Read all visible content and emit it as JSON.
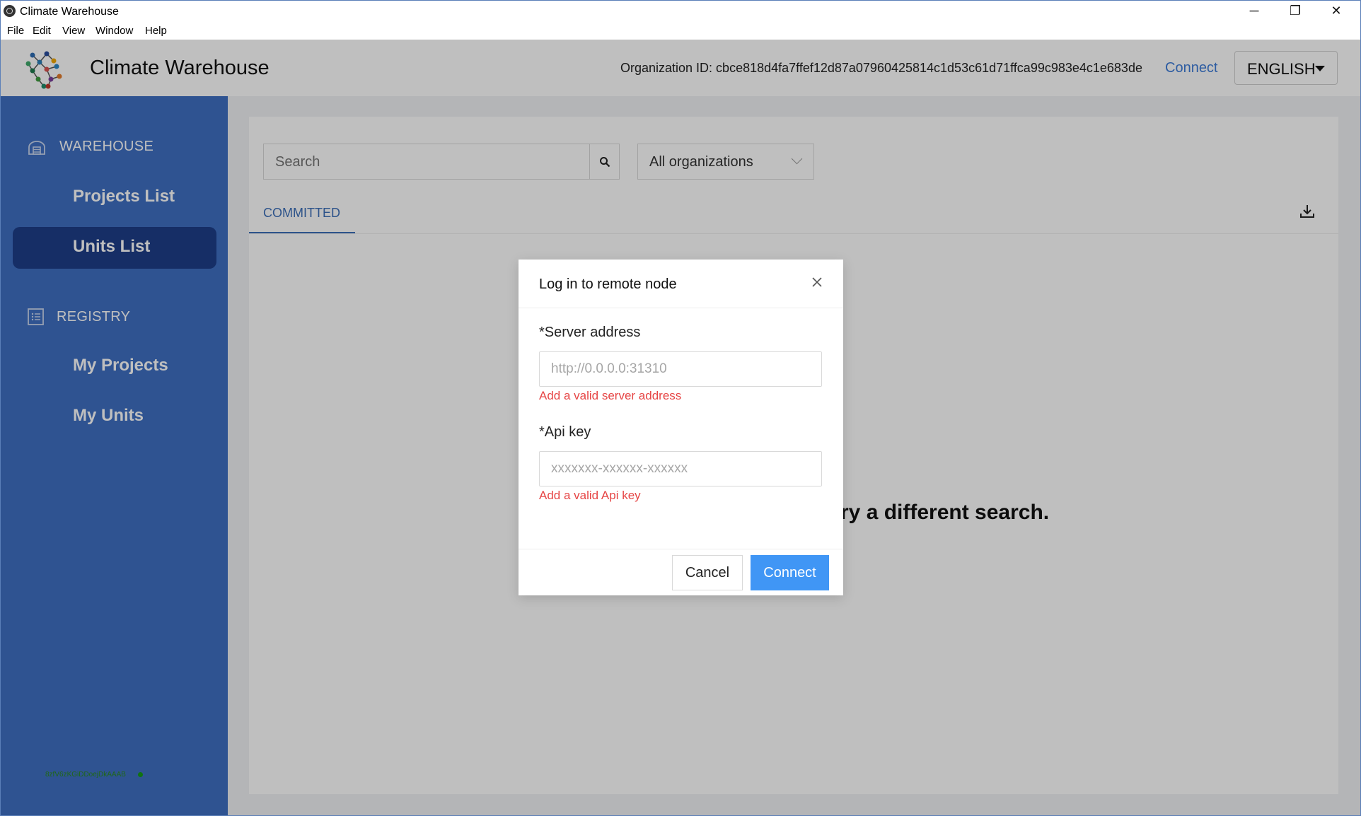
{
  "window": {
    "title": "Climate Warehouse",
    "minimize": "─",
    "maximize": "❐",
    "close": "✕"
  },
  "menu": [
    "File",
    "Edit",
    "View",
    "Window",
    "Help"
  ],
  "header": {
    "app_name": "Climate Warehouse",
    "org_id": "Organization ID: cbce818d4fa7ffef12d87a07960425814c1d53c61d71ffca99c983e4c1e683de",
    "connect_label": "Connect",
    "language": "ENGLISH"
  },
  "sidebar": {
    "warehouse_title": "WAREHOUSE",
    "warehouse_items": [
      "Projects List",
      "Units List"
    ],
    "registry_title": "REGISTRY",
    "registry_items": [
      "My Projects",
      "My Units"
    ],
    "status_text": "8zfV6zKGiDDoejDkAAAB",
    "active_item": "Units List"
  },
  "main": {
    "search_placeholder": "Search",
    "org_filter": "All organizations",
    "tab": "COMMITTED",
    "empty_text": "ry a different search."
  },
  "modal": {
    "title": "Log in to remote node",
    "server_label": "*Server address",
    "server_placeholder": "http://0.0.0.0:31310",
    "server_error": "Add a valid server address",
    "api_label": "*Api key",
    "api_placeholder": "xxxxxxx-xxxxxx-xxxxxx",
    "api_error": "Add a valid Api key",
    "cancel_label": "Cancel",
    "connect_label": "Connect"
  },
  "colors": {
    "sidebar": "#3f6fc2",
    "sidebar_active": "#1e3e88",
    "accent": "#4096f5",
    "error": "#e64545"
  }
}
